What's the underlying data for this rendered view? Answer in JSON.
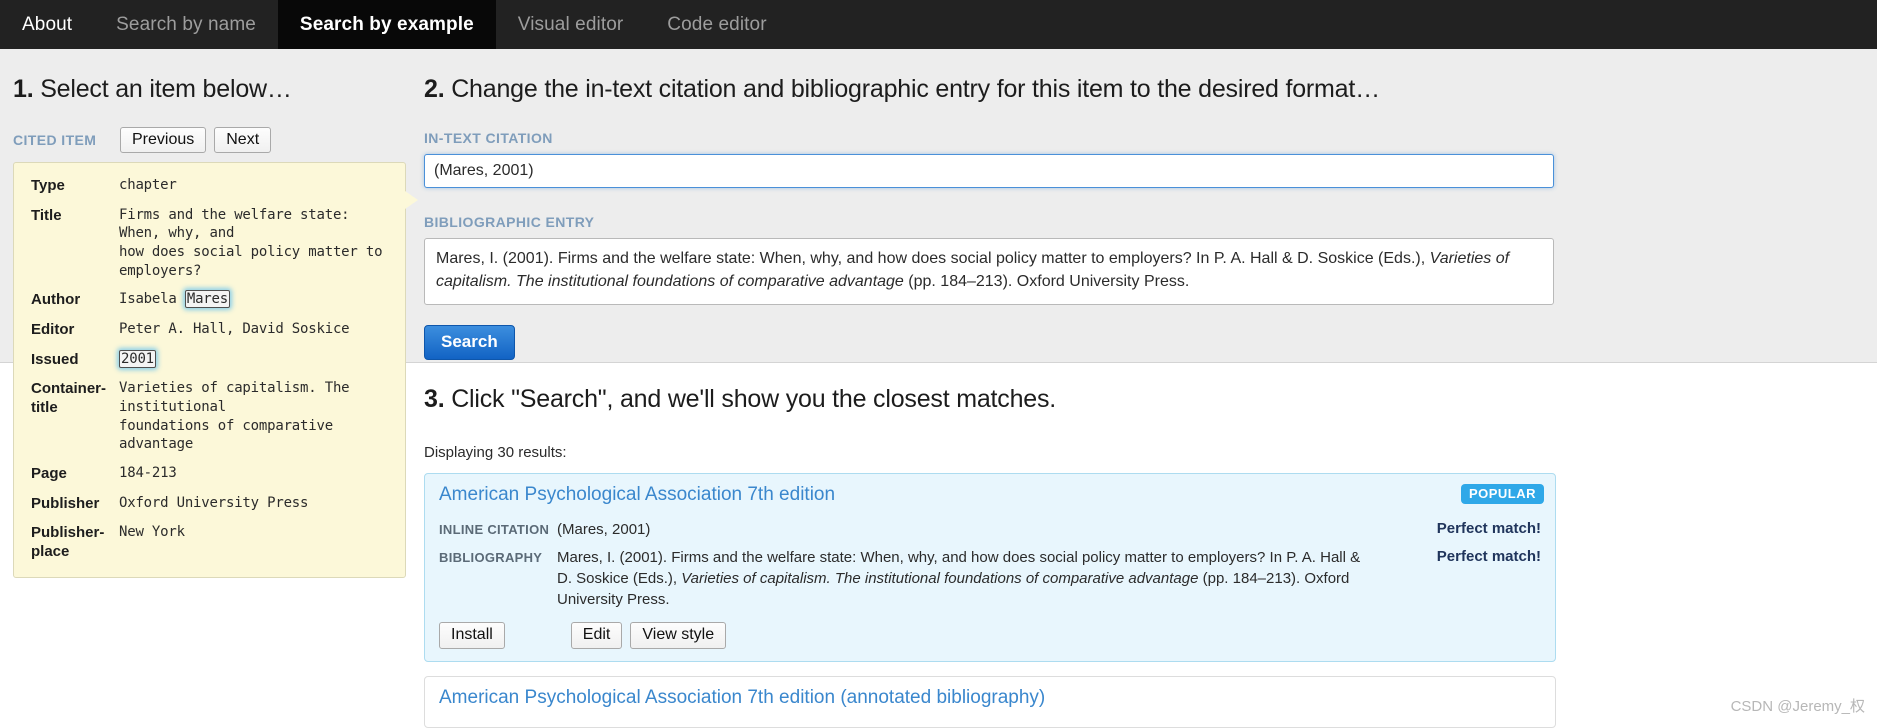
{
  "nav": {
    "items": [
      {
        "label": "About",
        "active": false
      },
      {
        "label": "Search by name",
        "active": false
      },
      {
        "label": "Search by example",
        "active": true
      },
      {
        "label": "Visual editor",
        "active": false
      },
      {
        "label": "Code editor",
        "active": false
      }
    ]
  },
  "step1": {
    "heading_num": "1.",
    "heading_text": " Select an item below…",
    "cited_item_label": "CITED ITEM",
    "previous_button": "Previous",
    "next_button": "Next",
    "fields": [
      {
        "key": "Type",
        "value": "chapter"
      },
      {
        "key": "Title",
        "value": "Firms and the welfare state: When, why, and\nhow does social policy matter to employers?"
      },
      {
        "key": "Author",
        "value_plain": "Isabela ",
        "value_highlight": "Mares"
      },
      {
        "key": "Editor",
        "value": "Peter A. Hall, David Soskice"
      },
      {
        "key": "Issued",
        "value_plain": "",
        "value_highlight": "2001"
      },
      {
        "key": "Container-title",
        "value": "Varieties of capitalism. The institutional\nfoundations of comparative advantage"
      },
      {
        "key": "Page",
        "value": "184-213"
      },
      {
        "key": "Publisher",
        "value": "Oxford University Press"
      },
      {
        "key": "Publisher-place",
        "value": "New York"
      }
    ]
  },
  "step2": {
    "heading_num": "2.",
    "heading_text": " Change the in-text citation and bibliographic entry for this item to the desired format…",
    "intext_label": "IN-TEXT CITATION",
    "intext_value": "(Mares, 2001)",
    "biblio_label": "BIBLIOGRAPHIC ENTRY",
    "biblio_part1": "Mares, I. (2001). Firms and the welfare state: When, why, and how does social policy matter to employers? In P. A. Hall & D. Soskice (Eds.), ",
    "biblio_italic1": "Varieties of capitalism. The institutional foundations of comparative advantage",
    "biblio_part2": " (pp. 184–213). Oxford University Press.",
    "search_button": "Search"
  },
  "step3": {
    "heading_num": "3.",
    "heading_text": " Click \"Search\", and we'll show you the closest matches.",
    "results_count_text": "Displaying 30 results:",
    "results": [
      {
        "title": "American Psychological Association 7th edition",
        "badge": "POPULAR",
        "inline_label": "INLINE CITATION",
        "inline_value": "(Mares, 2001)",
        "inline_match": "Perfect match!",
        "biblio_label": "BIBLIOGRAPHY",
        "biblio_part1": "Mares, I. (2001). Firms and the welfare state: When, why, and how does social policy matter to employers? In P. A. Hall & D. Soskice (Eds.), ",
        "biblio_italic1": "Varieties of capitalism. The institutional foundations of comparative advantage",
        "biblio_part2": " (pp. 184–213). Oxford University Press.",
        "biblio_match": "Perfect match!",
        "install_button": "Install",
        "edit_button": "Edit",
        "view_style_button": "View style"
      },
      {
        "title": "American Psychological Association 7th edition (annotated bibliography)"
      }
    ]
  },
  "watermark": "CSDN @Jeremy_权",
  "colors": {
    "nav_bg": "#222222",
    "nav_active_bg": "#080808",
    "accent_blue": "#3a87cd",
    "label_blue": "#7f9dbb",
    "cited_bg": "#fcf8d9",
    "result_bg": "#e8f6fd",
    "badge_bg": "#2fa8e8",
    "search_btn": "#1263c4"
  }
}
